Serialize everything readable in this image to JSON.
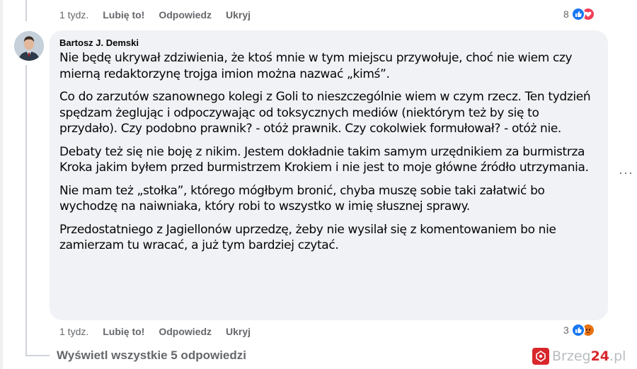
{
  "top_actions": {
    "time": "1 tydz.",
    "like": "Lubię to!",
    "reply": "Odpowiedz",
    "hide": "Ukryj",
    "reaction_count": "8",
    "reactions": [
      "like-icon",
      "love-icon"
    ]
  },
  "comment": {
    "author": "Bartosz J. Demski",
    "paragraphs": [
      "Nie będę ukrywał zdziwienia, że ktoś mnie w tym miejscu przywołuje, choć nie wiem czy mierną redaktorzynę trojga imion można nazwać „kimś”.",
      "Co do zarzutów szanownego kolegi z Goli to nieszczególnie wiem w czym rzecz. Ten tydzień spędzam żeglując i odpoczywając od toksycznych mediów (niektórym też by się to przydało). Czy podobno prawnik? - otóż prawnik. Czy cokolwiek formułował? - otóż nie.",
      "Debaty też się nie boję z nikim. Jestem dokładnie takim samym urzędnikiem za burmistrza Kroka jakim byłem przed burmistrzem Krokiem i nie jest to moje główne źródło utrzymania.",
      "Nie mam też „stołka”, którego mógłbym bronić, chyba muszę sobie taki załatwić bo wychodzę na naiwniaka, który robi to wszystko w imię słusznej sprawy.",
      "Przedostatniego z Jagiellonów uprzedzę, żeby nie wysilał się z komentowaniem bo nie zamierzam tu wracać, a już tym bardziej czytać."
    ]
  },
  "bottom_actions": {
    "time": "1 tydz.",
    "like": "Lubię to!",
    "reply": "Odpowiedz",
    "hide": "Ukryj",
    "reaction_count": "3",
    "reactions": [
      "like-icon",
      "angry-icon"
    ]
  },
  "view_all_replies": "Wyświetl wszystkie 5 odpowiedzi",
  "more_options": "···",
  "watermark": {
    "brand": "Brzeg",
    "number": "24",
    "tld": ".pl"
  },
  "colors": {
    "bubble": "#f0f2f5",
    "like": "#1877f2",
    "love": "#f33e58",
    "angry": "#e9710f",
    "muted": "#65676b",
    "brand_red": "#d8262b"
  }
}
